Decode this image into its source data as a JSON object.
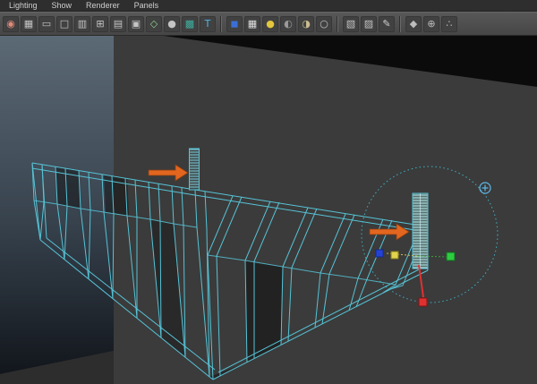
{
  "menu_bar": {
    "items": [
      {
        "name": "lighting-menu",
        "label": "Lighting"
      },
      {
        "name": "show-menu",
        "label": "Show"
      },
      {
        "name": "renderer-menu",
        "label": "Renderer"
      },
      {
        "name": "panels-menu",
        "label": "Panels"
      }
    ]
  },
  "toolbar": {
    "icons": [
      {
        "name": "select-camera-icon",
        "glyph": "◉",
        "color": "#e08a7a"
      },
      {
        "name": "grid-icon",
        "glyph": "▦",
        "color": "#c4c4c4"
      },
      {
        "name": "film-gate-icon",
        "glyph": "▭",
        "color": "#c4c4c4"
      },
      {
        "name": "resolution-gate-icon",
        "glyph": "□",
        "color": "#c4c4c4"
      },
      {
        "name": "gate-mask-icon",
        "glyph": "▥",
        "color": "#c4c4c4"
      },
      {
        "name": "field-chart-icon",
        "glyph": "⊞",
        "color": "#c4c4c4"
      },
      {
        "name": "safe-action-icon",
        "glyph": "▤",
        "color": "#c4c4c4"
      },
      {
        "name": "safe-title-icon",
        "glyph": "▣",
        "color": "#c4c4c4"
      },
      {
        "name": "wireframe-icon",
        "glyph": "◇",
        "color": "#8fcf8f"
      },
      {
        "name": "shaded-icon",
        "glyph": "●",
        "color": "#c4c4c4"
      },
      {
        "name": "textured-icon",
        "glyph": "▩",
        "color": "#3fae9f"
      },
      {
        "name": "hud-icon",
        "glyph": "T",
        "color": "#4db6e8"
      },
      {
        "separator": true
      },
      {
        "name": "default-material-icon",
        "glyph": "◼",
        "color": "#3b6fd4"
      },
      {
        "name": "checkerboard-icon",
        "glyph": "▦",
        "color": "#e0e0e0"
      },
      {
        "name": "all-lights-icon",
        "glyph": "●",
        "color": "#e3c63c"
      },
      {
        "name": "shadows-icon",
        "glyph": "◐",
        "color": "#9a9a9a"
      },
      {
        "name": "ambient-occlusion-icon",
        "glyph": "◑",
        "color": "#c9bd92"
      },
      {
        "name": "motion-blur-icon",
        "glyph": "○",
        "color": "#c4c4c4"
      },
      {
        "separator": true
      },
      {
        "name": "isolate-select-icon",
        "glyph": "▧",
        "color": "#c4c4c4"
      },
      {
        "name": "xray-icon",
        "glyph": "▨",
        "color": "#c4c4c4"
      },
      {
        "name": "grease-pencil-icon",
        "glyph": "✎",
        "color": "#d0d0d0"
      },
      {
        "separator": true
      },
      {
        "name": "scene-cube-icon",
        "glyph": "◆",
        "color": "#bdbdbd"
      },
      {
        "name": "render-globe-icon",
        "glyph": "⊕",
        "color": "#bdbdbd"
      },
      {
        "name": "share-icon",
        "glyph": "∴",
        "color": "#bdbdbd"
      }
    ]
  },
  "viewport": {
    "colors": {
      "background": "#3b3b3b",
      "wall_top": "#5c6a76",
      "wall_mid": "#37424d",
      "wall_bottom": "#12161c",
      "ceiling_face": "#0b0b0b",
      "wireframe": "#56c3d6",
      "selection_hatch": "#b5ecef",
      "annotation_arrow": "#e2661f",
      "manipulator_circle": "#3fbcd1",
      "axis_x": "#e03131",
      "axis_y": "#2ecc40",
      "axis_z": "#2443d6",
      "center_handle": "#e3d34b"
    }
  }
}
